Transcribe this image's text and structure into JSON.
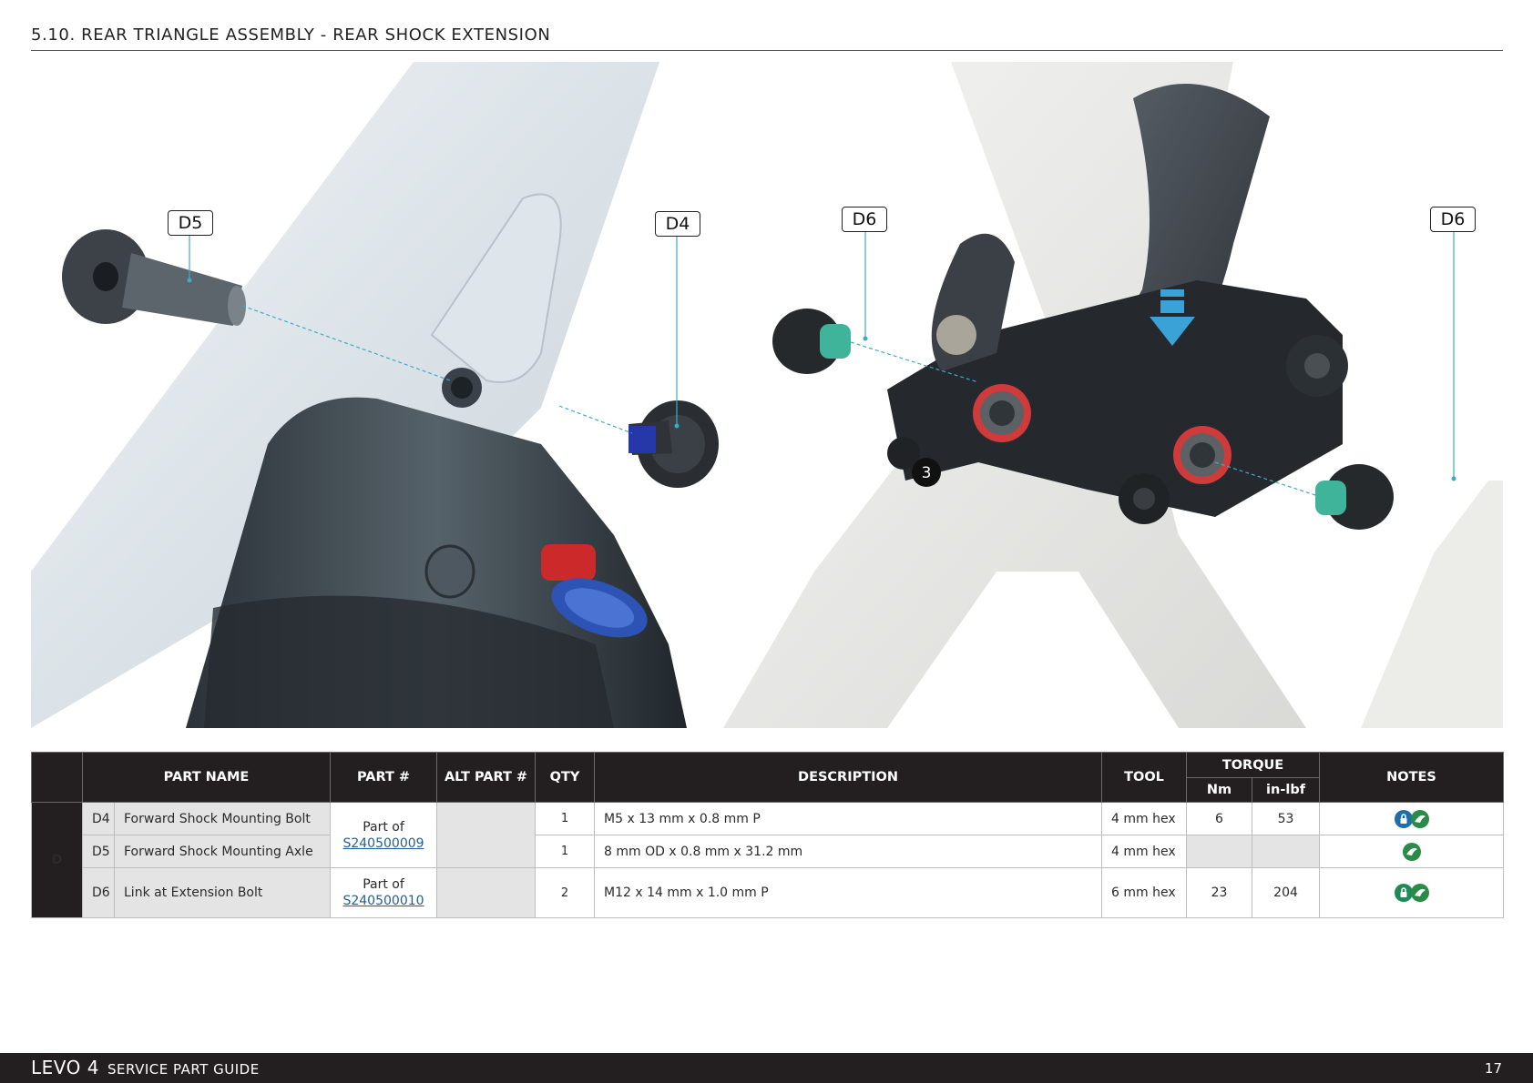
{
  "page": {
    "title": "5.10. REAR TRIANGLE ASSEMBLY - REAR SHOCK EXTENSION"
  },
  "illustration": {
    "callouts": [
      "D5",
      "D4",
      "D6",
      "D6"
    ],
    "marker": "3"
  },
  "table": {
    "headers": {
      "part_name": "PART NAME",
      "part_num": "PART #",
      "alt_part": "ALT PART #",
      "qty": "QTY",
      "description": "DESCRIPTION",
      "tool": "TOOL",
      "torque": "TORQUE",
      "nm": "Nm",
      "inlbf": "in-lbf",
      "notes": "NOTES"
    },
    "group": "D",
    "rows": [
      {
        "id": "D4",
        "name": "Forward Shock Mounting Bolt",
        "qty": "1",
        "description": "M5 x 13 mm x 0.8 mm P",
        "tool": "4 mm hex",
        "nm": "6",
        "inlbf": "53",
        "notes": [
          "threadlock-icon",
          "bike-icon"
        ]
      },
      {
        "id": "D5",
        "name": "Forward Shock Mounting Axle",
        "qty": "1",
        "description": "8 mm OD x 0.8 mm x 31.2 mm",
        "tool": "4 mm hex",
        "nm": "",
        "inlbf": "",
        "notes": [
          "bike-icon"
        ]
      },
      {
        "id": "D6",
        "name": "Link at Extension Bolt",
        "qty": "2",
        "description": "M12 x 14 mm x 1.0 mm P",
        "tool": "6 mm hex",
        "nm": "23",
        "inlbf": "204",
        "notes": [
          "threadlock-icon",
          "bike-icon"
        ]
      }
    ],
    "part_groups": [
      {
        "prefix": "Part of",
        "link": "S240500009"
      },
      {
        "prefix": "Part of",
        "link": "S240500010"
      }
    ]
  },
  "footer": {
    "brand": "LEVO 4",
    "guide": "SERVICE PART GUIDE",
    "page_number": "17"
  },
  "colors": {
    "header_bg": "#231f20",
    "link": "#245e95",
    "threadlock_blue": "#1c6fab",
    "grease_green": "#2a8a48",
    "callout_line": "#3fa9c9"
  }
}
